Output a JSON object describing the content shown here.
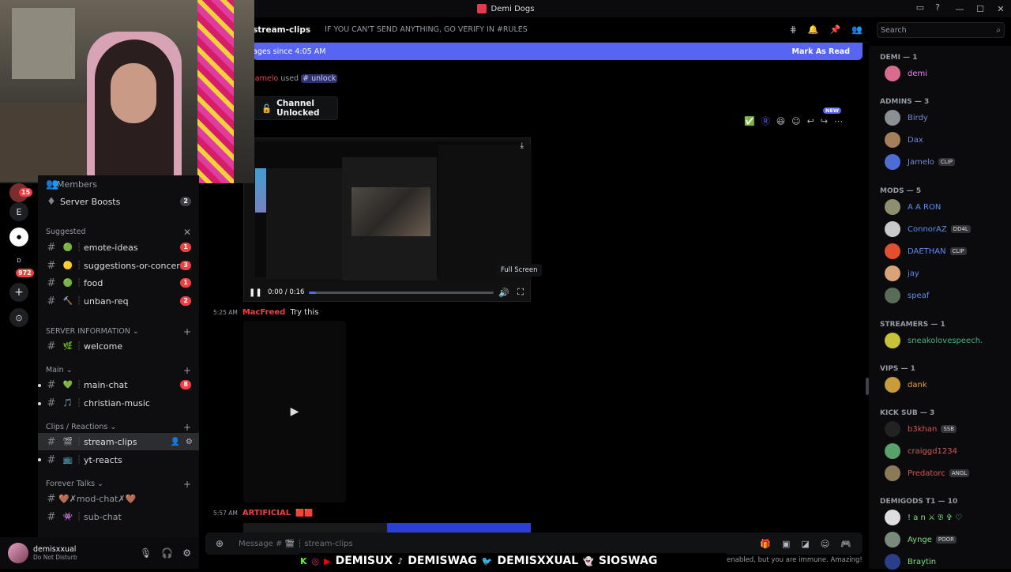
{
  "window": {
    "title": "Demi Dogs"
  },
  "webcam": {
    "label": "streamer-webcam"
  },
  "server_rail": {
    "badges": [
      "15",
      "E",
      "D",
      "972"
    ]
  },
  "sidebar": {
    "members_label": "Members",
    "server_boosts": {
      "label": "Server Boosts",
      "count": "2"
    },
    "suggested_label": "Suggested",
    "suggested": [
      {
        "emoji": "🟢",
        "name": "emote-ideas",
        "count": "1"
      },
      {
        "emoji": "🟡",
        "name": "suggestions-or-concerns",
        "count": "3"
      },
      {
        "emoji": "🟢",
        "name": "food",
        "count": "1"
      },
      {
        "emoji": "🔨",
        "name": "unban-req",
        "count": "2"
      }
    ],
    "server_info_label": "SERVER INFORMATION",
    "server_info": [
      {
        "emoji": "🌿",
        "name": "welcome"
      }
    ],
    "main_label": "Main",
    "main": [
      {
        "emoji": "💚",
        "name": "main-chat",
        "count": "8"
      },
      {
        "emoji": "🎵",
        "name": "christian-music"
      }
    ],
    "clips_label": "Clips / Reactions",
    "clips": [
      {
        "emoji": "🎬",
        "name": "stream-clips"
      },
      {
        "emoji": "📺",
        "name": "yt-reacts"
      }
    ],
    "forever_label": "Forever Talks",
    "forever": [
      {
        "emoji": "",
        "name": "🤎✗mod-chat✗🤎"
      },
      {
        "emoji": "👾",
        "name": "sub-chat"
      }
    ]
  },
  "user": {
    "name": "demisxxual",
    "status": "Do Not Disturb"
  },
  "channel": {
    "name": "stream-clips",
    "topic": "IF YOU CAN'T SEND ANYTHING, GO VERIFY IN #RULES"
  },
  "new_bar": {
    "text": "ages since 4:05 AM",
    "mark": "Mark As Read"
  },
  "system_msg": {
    "user": "Jamelo",
    "used": "used",
    "channel": "# unlock"
  },
  "unlocked_card": {
    "text": "Channel Unlocked"
  },
  "new_tag": "NEW",
  "video": {
    "time": "0:00 / 0:16",
    "tooltip": "Full Screen",
    "progress": 0.04
  },
  "messages": [
    {
      "time": "5:25 AM",
      "author": "MacFreed",
      "text": "Try this"
    },
    {
      "time": "5:57 AM",
      "author": "ARTIFICIAL",
      "text": ""
    }
  ],
  "input": {
    "placeholder": "Message # 🎬 ┆ stream-clips"
  },
  "ticker": {
    "items": [
      "DEMISUX",
      "DEMISWAG",
      "DEMISXXUAL",
      "SIOSWAG"
    ]
  },
  "immune_text": "enabled, but you are immune. Amazing!",
  "search": {
    "placeholder": "Search"
  },
  "member_list": {
    "groups": [
      {
        "header": "DEMI — 1",
        "members": [
          {
            "name": "demi",
            "color": "#f47fff",
            "tag": ""
          }
        ]
      },
      {
        "header": "ADMINS — 3",
        "members": [
          {
            "name": "Birdy",
            "color": "#7289da",
            "tag": ""
          },
          {
            "name": "Dax",
            "color": "#7289da",
            "tag": ""
          },
          {
            "name": "Jamelo",
            "color": "#7289da",
            "tag": "CLIP"
          }
        ]
      },
      {
        "header": "MODS — 5",
        "members": [
          {
            "name": "A A RON",
            "color": "#5b8def",
            "tag": ""
          },
          {
            "name": "ConnorAZ",
            "color": "#5b8def",
            "tag": "DD4L"
          },
          {
            "name": "DAETHAN",
            "color": "#5b8def",
            "tag": "CLIP"
          },
          {
            "name": "jay",
            "color": "#5b8def",
            "tag": ""
          },
          {
            "name": "speaf",
            "color": "#5b8def",
            "tag": ""
          }
        ]
      },
      {
        "header": "STREAMERS — 1",
        "members": [
          {
            "name": "sneakolovespeech.",
            "color": "#43b581",
            "tag": ""
          }
        ]
      },
      {
        "header": "VIPS — 1",
        "members": [
          {
            "name": "dank",
            "color": "#e6a23c",
            "tag": ""
          }
        ]
      },
      {
        "header": "KICK SUB — 3",
        "members": [
          {
            "name": "b3khan",
            "color": "#d65656",
            "tag": "SSB"
          },
          {
            "name": "craiggd1234",
            "color": "#d65656",
            "tag": ""
          },
          {
            "name": "Predatorc",
            "color": "#d65656",
            "tag": "ANGL"
          }
        ]
      },
      {
        "header": "DEMIGODS T1 — 10",
        "members": [
          {
            "name": "! a n ⚔ 𝔅 ✞ ♡",
            "color": "#7ee07e",
            "tag": ""
          },
          {
            "name": "Aynge",
            "color": "#7ee07e",
            "tag": "POOR"
          },
          {
            "name": "Braytin",
            "color": "#7ee07e",
            "tag": ""
          }
        ]
      }
    ]
  }
}
